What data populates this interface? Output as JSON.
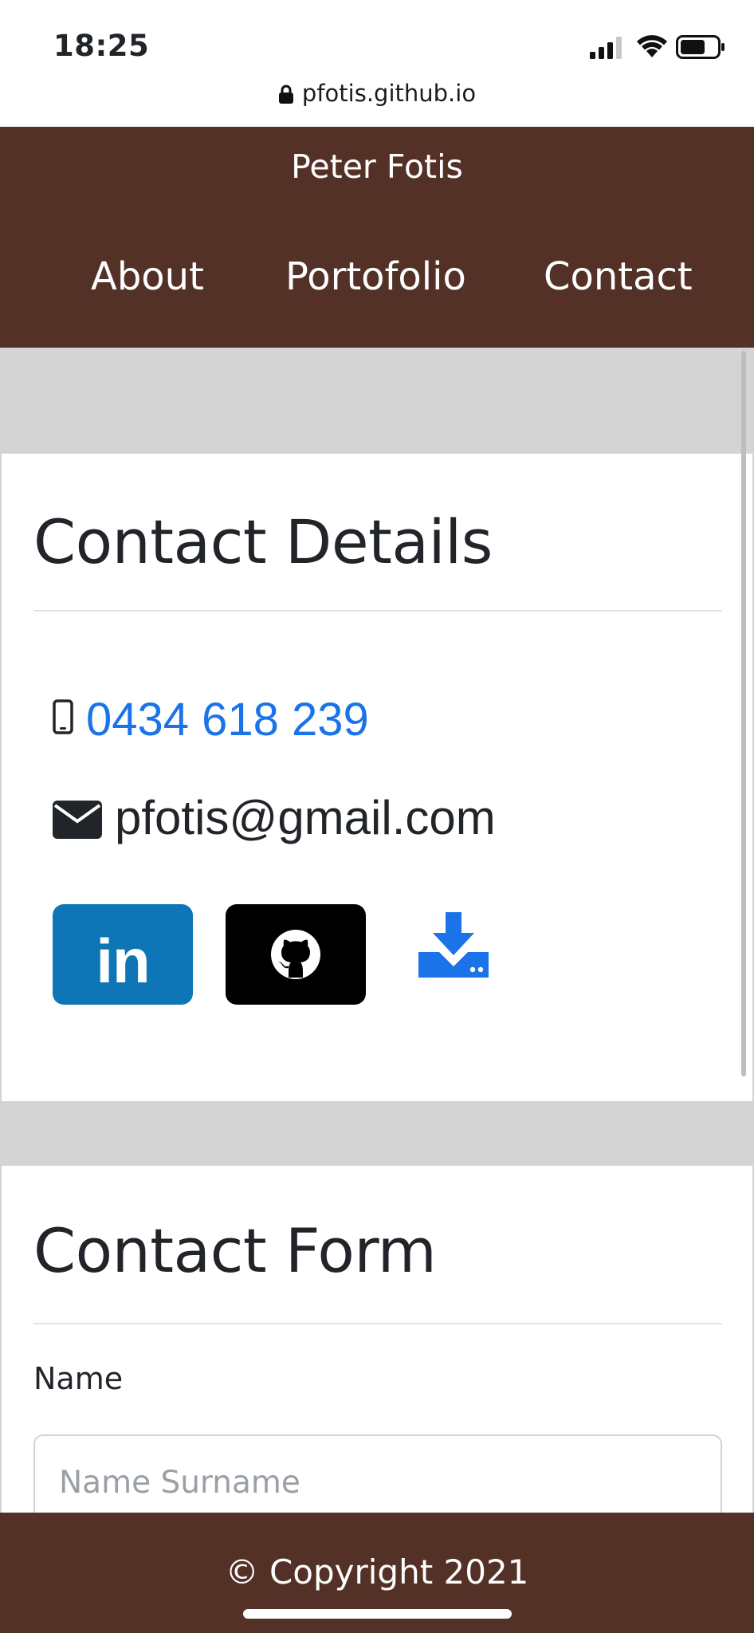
{
  "status_bar": {
    "time": "18:25",
    "url": "pfotis.github.io",
    "icons": [
      "cellular-signal-icon",
      "wifi-icon",
      "battery-icon",
      "lock-icon"
    ]
  },
  "header": {
    "site_title": "Peter Fotis",
    "nav": [
      {
        "label": "About"
      },
      {
        "label": "Portofolio"
      },
      {
        "label": "Contact"
      }
    ]
  },
  "contact_details": {
    "title": "Contact Details",
    "phone": "0434 618 239",
    "email": "pfotis@gmail.com",
    "social": [
      {
        "name": "LinkedIn",
        "label": "in",
        "color": "#0e76b6"
      },
      {
        "name": "GitHub",
        "color": "#000000"
      },
      {
        "name": "Download",
        "icon": "download-icon",
        "color": "#1a73e8"
      }
    ]
  },
  "contact_form": {
    "title": "Contact Form",
    "name_label": "Name",
    "name_placeholder": "Name Surname",
    "name_value": ""
  },
  "footer": {
    "copyright": "© Copyright 2021"
  },
  "colors": {
    "brand": "#543127",
    "link": "#1a73e8",
    "page_background": "#d4d4d4"
  }
}
